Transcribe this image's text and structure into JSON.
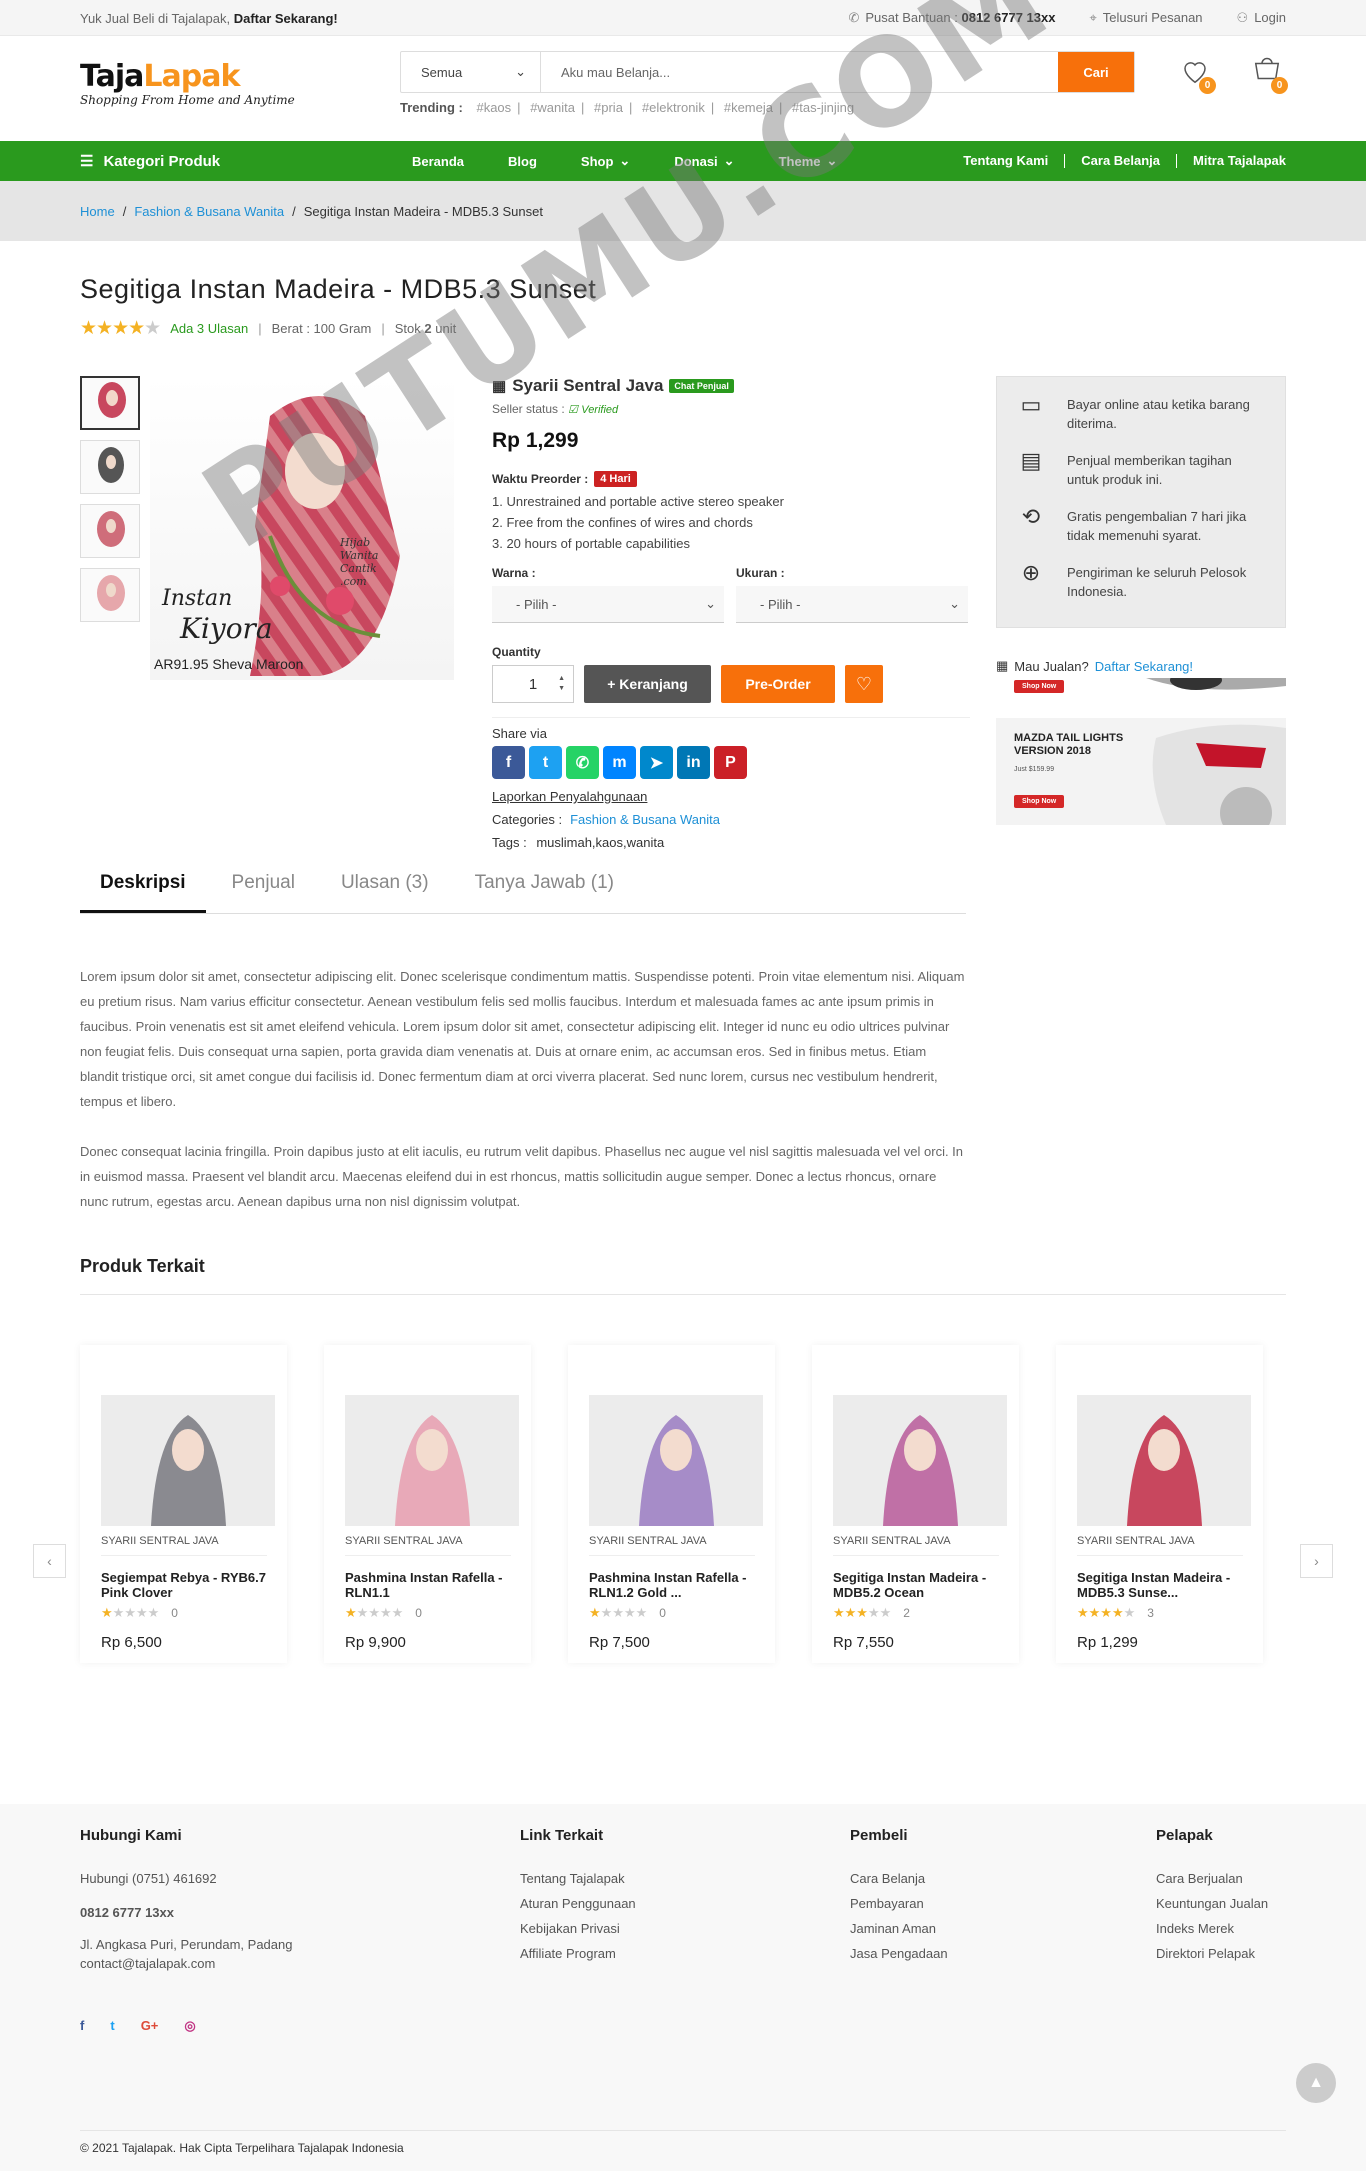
{
  "topbar": {
    "promo": "Yuk Jual Beli di Tajalapak,",
    "promo_link": "Daftar Sekarang!",
    "help_label": "Pusat Bantuan :",
    "help_phone": "0812 6777 13xx",
    "track": "Telusuri Pesanan",
    "login": "Login"
  },
  "header": {
    "logo_a": "Taja",
    "logo_b": "Lapak",
    "logo_tagline": "Shopping From Home and Anytime",
    "search_select": "Semua",
    "search_placeholder": "Aku mau Belanja...",
    "search_button": "Cari",
    "trending_label": "Trending :",
    "trending": [
      "#kaos",
      "#wanita",
      "#pria",
      "#elektronik",
      "#kemeja",
      "#tas-jinjing"
    ],
    "wishlist_count": "0",
    "cart_count": "0"
  },
  "nav": {
    "category": "Kategori Produk",
    "main": [
      "Beranda",
      "Blog",
      "Shop",
      "Donasi",
      "Theme"
    ],
    "right": [
      "Tentang Kami",
      "Cara Belanja",
      "Mitra Tajalapak"
    ]
  },
  "breadcrumb": {
    "home": "Home",
    "category": "Fashion & Busana Wanita",
    "current": "Segitiga Instan Madeira - MDB5.3 Sunset"
  },
  "product": {
    "title": "Segitiga Instan Madeira - MDB5.3 Sunset",
    "rating": 4,
    "reviews": "Ada 3 Ulasan",
    "weight": "Berat : 100 Gram",
    "stock_label": "Stok",
    "stock_value": "2",
    "stock_unit": "unit",
    "image_text_1": "Instan",
    "image_text_2": "Kiyora",
    "image_caption": "AR91.95 Sheva Maroon",
    "image_mark": "Hijab Wanita Cantik .com",
    "seller": "Syarii Sentral Java",
    "chat": "Chat Penjual",
    "seller_status_label": "Seller status :",
    "seller_status": "Verified",
    "price": "Rp 1,299",
    "preorder_label": "Waktu Preorder :",
    "preorder_value": "4 Hari",
    "features": [
      "1. Unrestrained and portable active stereo speaker",
      "2. Free from the confines of wires and chords",
      "3. 20 hours of portable capabilities"
    ],
    "color_label": "Warna :",
    "color_value": "- Pilih -",
    "size_label": "Ukuran :",
    "size_value": "- Pilih -",
    "qty_label": "Quantity",
    "qty": "1",
    "cart_btn": "+ Keranjang",
    "preorder_btn": "Pre-Order",
    "share_label": "Share via",
    "report": "Laporkan Penyalahgunaan",
    "categories_label": "Categories :",
    "categories_value": "Fashion & Busana Wanita",
    "tags_label": "Tags :",
    "tags_value": "muslimah,kaos,wanita"
  },
  "side": {
    "items": [
      "Bayar online atau ketika barang diterima.",
      "Penjual memberikan tagihan untuk produk ini.",
      "Gratis pengembalian 7 hari jika tidak memenuhi syarat.",
      "Pengiriman ke seluruh Pelosok Indonesia."
    ],
    "sell_q": "Mau Jualan?",
    "sell_link": "Daftar Sekarang!",
    "shop_now": "Shop Now",
    "banner_title": "MAZDA TAIL LIGHTS VERSION 2018",
    "banner_price": "Just $159.99"
  },
  "tabs": [
    "Deskripsi",
    "Penjual",
    "Ulasan (3)",
    "Tanya Jawab (1)"
  ],
  "description": [
    "Lorem ipsum dolor sit amet, consectetur adipiscing elit. Donec scelerisque condimentum mattis. Suspendisse potenti. Proin vitae elementum nisi. Aliquam eu pretium risus. Nam varius efficitur consectetur. Aenean vestibulum felis sed mollis faucibus. Interdum et malesuada fames ac ante ipsum primis in faucibus. Proin venenatis est sit amet eleifend vehicula. Lorem ipsum dolor sit amet, consectetur adipiscing elit. Integer id nunc eu odio ultrices pulvinar non feugiat felis. Duis consequat urna sapien, porta gravida diam venenatis at. Duis at ornare enim, ac accumsan eros. Sed in finibus metus. Etiam blandit tristique orci, sit amet congue dui facilisis id. Donec fermentum diam at orci viverra placerat. Sed nunc lorem, cursus nec vestibulum hendrerit, tempus et libero.",
    "Donec consequat lacinia fringilla. Proin dapibus justo at elit iaculis, eu rutrum velit dapibus. Phasellus nec augue vel nisl sagittis malesuada vel vel orci. In in euismod massa. Praesent vel blandit arcu. Maecenas eleifend dui in est rhoncus, mattis sollicitudin augue semper. Donec a lectus rhoncus, ornare nunc rutrum, egestas arcu. Aenean dapibus urna non nisl dignissim volutpat."
  ],
  "related": {
    "title": "Produk Terkait",
    "items": [
      {
        "store": "SYARII SENTRAL JAVA",
        "name": "Segiempat Rebya - RYB6.7 Pink Clover",
        "rating": 1,
        "reviews": "0",
        "price": "Rp 6,500",
        "color": "#8a8a90"
      },
      {
        "store": "SYARII SENTRAL JAVA",
        "name": "Pashmina Instan Rafella - RLN1.1",
        "rating": 1,
        "reviews": "0",
        "price": "Rp 9,900",
        "color": "#e8a9b8"
      },
      {
        "store": "SYARII SENTRAL JAVA",
        "name": "Pashmina Instan Rafella - RLN1.2 Gold ...",
        "rating": 1,
        "reviews": "0",
        "price": "Rp 7,500",
        "color": "#a68cc8"
      },
      {
        "store": "SYARII SENTRAL JAVA",
        "name": "Segitiga Instan Madeira - MDB5.2 Ocean",
        "rating": 3,
        "reviews": "2",
        "price": "Rp 7,550",
        "color": "#c070a6"
      },
      {
        "store": "SYARII SENTRAL JAVA",
        "name": "Segitiga Instan Madeira - MDB5.3 Sunse...",
        "rating": 4,
        "reviews": "3",
        "price": "Rp 1,299",
        "color": "#c8475e"
      }
    ]
  },
  "footer": {
    "contact_title": "Hubungi Kami",
    "phone_label": "Hubungi (0751) 461692",
    "phone": "0812 6777 13xx",
    "address": "Jl. Angkasa Puri, Perundam, Padang",
    "email": "contact@tajalapak.com",
    "links_title": "Link Terkait",
    "links": [
      "Tentang Tajalapak",
      "Aturan Penggunaan",
      "Kebijakan Privasi",
      "Affiliate Program"
    ],
    "buyer_title": "Pembeli",
    "buyer": [
      "Cara Belanja",
      "Pembayaran",
      "Jaminan Aman",
      "Jasa Pengadaan"
    ],
    "seller_title": "Pelapak",
    "seller": [
      "Cara Berjualan",
      "Keuntungan Jualan",
      "Indeks Merek",
      "Direktori Pelapak"
    ],
    "copyright": "© 2021 Tajalapak. Hak Cipta Terpelihara Tajalapak Indonesia"
  },
  "watermark": "PUTUMU.COM",
  "colors": {
    "green": "#2a9a1e",
    "orange": "#f7700b",
    "link": "#1e90d6"
  }
}
